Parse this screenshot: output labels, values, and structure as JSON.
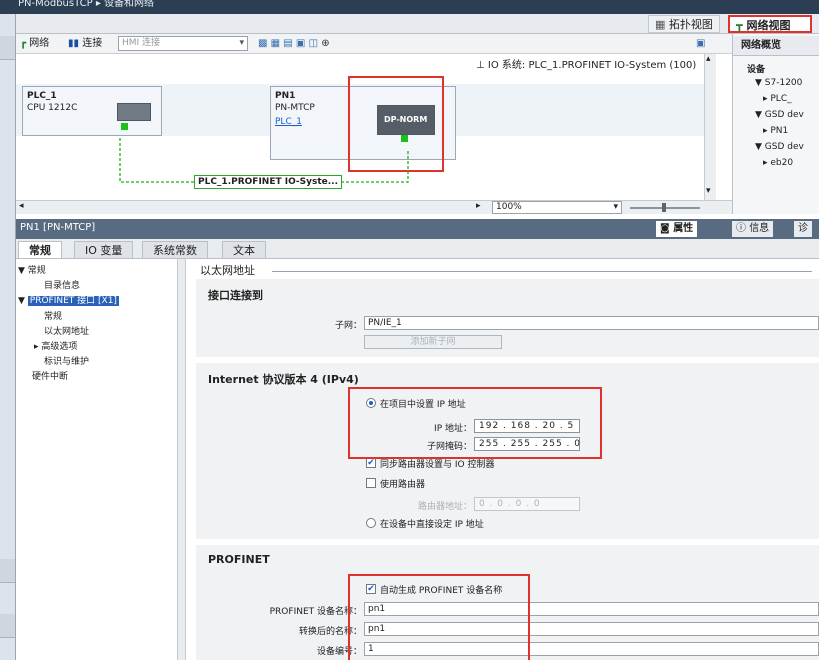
{
  "title_bar": {
    "breadcrumb": "PN-ModbusTCP ▸ 设备和网络"
  },
  "view_tabs": {
    "topology": "拓扑视图",
    "network": "网络视图"
  },
  "toolbar": {
    "network": "网络",
    "connections": "连接",
    "connection_type": "HMI 连接",
    "zoom_icon": "zoom-icon"
  },
  "canvas": {
    "io_system": "IO 系统: PLC_1.PROFINET IO-System (100)",
    "plc": {
      "name": "PLC_1",
      "type": "CPU 1212C"
    },
    "pn1": {
      "name": "PN1",
      "type": "PN-MTCP",
      "link": "PLC_1"
    },
    "dp_module": "DP-NORM",
    "net_label": "PLC_1.PROFINET IO-Syste..."
  },
  "zoom": {
    "value": "100%"
  },
  "right_panel": {
    "tab": "网络概览",
    "rows": [
      "设备",
      "▼ S7-1200",
      "▸ PLC_",
      "▼ GSD dev",
      "▸ PN1",
      "▼ GSD dev",
      "▸ eb20"
    ]
  },
  "properties": {
    "title": "PN1 [PN-MTCP]",
    "tab_properties": "属性",
    "tab_info": "信息",
    "tab_diag": "诊"
  },
  "subtabs": [
    "常规",
    "IO 变量",
    "系统常数",
    "文本"
  ],
  "nav": {
    "general": "▼ 常规",
    "catalog": "目录信息",
    "profinet_port": "PROFINET 接口 [X1]",
    "pn_general": "常规",
    "ethernet": "以太网地址",
    "advanced": "▸ 高级选项",
    "ident": "标识与维护",
    "hw_interrupt": "硬件中断"
  },
  "content": {
    "ethernet_heading": "以太网地址",
    "interface_section": {
      "title": "接口连接到",
      "subnet_label": "子网：",
      "subnet_value": "PN/IE_1",
      "add_subnet": "添加新子网"
    },
    "ipv4": {
      "title": "Internet 协议版本 4 (IPv4)",
      "set_in_project": "在项目中设置 IP 地址",
      "ip_label": "IP 地址：",
      "ip_value": "192 . 168 . 20  .  5",
      "mask_label": "子网掩码：",
      "mask_value": "255 . 255 . 255 . 0",
      "sync_router": "同步路由器设置与 IO 控制器",
      "use_router": "使用路由器",
      "router_label": "路由器地址：",
      "router_value": "0  .  0  .  0  .  0",
      "set_on_device": "在设备中直接设定 IP 地址"
    },
    "profinet": {
      "title": "PROFINET",
      "auto_name": "自动生成 PROFINET 设备名称",
      "device_name_label": "PROFINET 设备名称：",
      "device_name_value": "pn1",
      "converted_label": "转换后的名称：",
      "converted_value": "pn1",
      "device_number_label": "设备编号：",
      "device_number_value": "1"
    }
  }
}
